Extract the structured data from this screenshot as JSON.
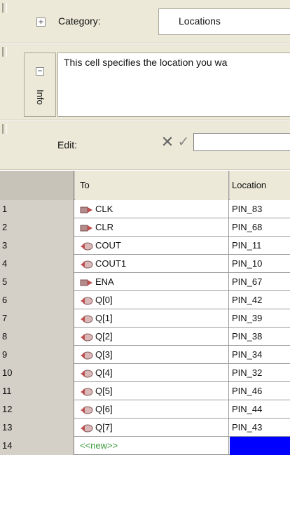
{
  "category_panel": {
    "label": "Category:",
    "value": "Locations",
    "expander": "+"
  },
  "info_panel": {
    "collapse": "−",
    "tab_label": "Info",
    "text": "This cell specifies the location you wa"
  },
  "edit_panel": {
    "label": "Edit:",
    "cancel": "✕",
    "accept": "✓",
    "value": ""
  },
  "grid": {
    "headers": {
      "to": "To",
      "location": "Location"
    },
    "rows": [
      {
        "num": "1",
        "to": "CLK",
        "loc": "PIN_83",
        "icon": "input-pin-icon"
      },
      {
        "num": "2",
        "to": "CLR",
        "loc": "PIN_68",
        "icon": "input-pin-icon"
      },
      {
        "num": "3",
        "to": "COUT",
        "loc": "PIN_11",
        "icon": "output-pin-icon"
      },
      {
        "num": "4",
        "to": "COUT1",
        "loc": "PIN_10",
        "icon": "output-pin-icon"
      },
      {
        "num": "5",
        "to": "ENA",
        "loc": "PIN_67",
        "icon": "input-pin-icon"
      },
      {
        "num": "6",
        "to": "Q[0]",
        "loc": "PIN_42",
        "icon": "output-pin-icon"
      },
      {
        "num": "7",
        "to": "Q[1]",
        "loc": "PIN_39",
        "icon": "output-pin-icon"
      },
      {
        "num": "8",
        "to": "Q[2]",
        "loc": "PIN_38",
        "icon": "output-pin-icon"
      },
      {
        "num": "9",
        "to": "Q[3]",
        "loc": "PIN_34",
        "icon": "output-pin-icon"
      },
      {
        "num": "10",
        "to": "Q[4]",
        "loc": "PIN_32",
        "icon": "output-pin-icon"
      },
      {
        "num": "11",
        "to": "Q[5]",
        "loc": "PIN_46",
        "icon": "output-pin-icon"
      },
      {
        "num": "12",
        "to": "Q[6]",
        "loc": "PIN_44",
        "icon": "output-pin-icon"
      },
      {
        "num": "13",
        "to": "Q[7]",
        "loc": "PIN_43",
        "icon": "output-pin-icon"
      },
      {
        "num": "14",
        "to": "<<new>>",
        "loc": "",
        "icon": "",
        "is_new": true
      }
    ],
    "new_row_color": "#0000ff",
    "new_text_color": "#3a9a3a"
  }
}
